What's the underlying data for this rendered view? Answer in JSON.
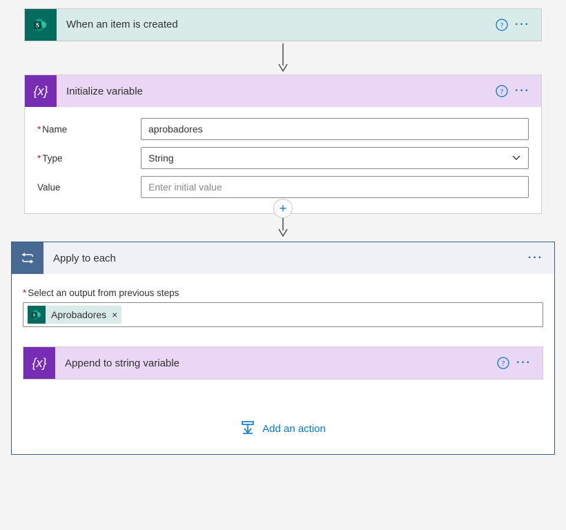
{
  "trigger": {
    "title": "When an item is created"
  },
  "initVar": {
    "title": "Initialize variable",
    "fields": {
      "name_label": "Name",
      "name_value": "aprobadores",
      "type_label": "Type",
      "type_value": "String",
      "value_label": "Value",
      "value_placeholder": "Enter initial value"
    }
  },
  "loop": {
    "title": "Apply to each",
    "select_label": "Select an output from previous steps",
    "token_label": "Aprobadores"
  },
  "append": {
    "title": "Append to string variable"
  },
  "add_action_label": "Add an action"
}
